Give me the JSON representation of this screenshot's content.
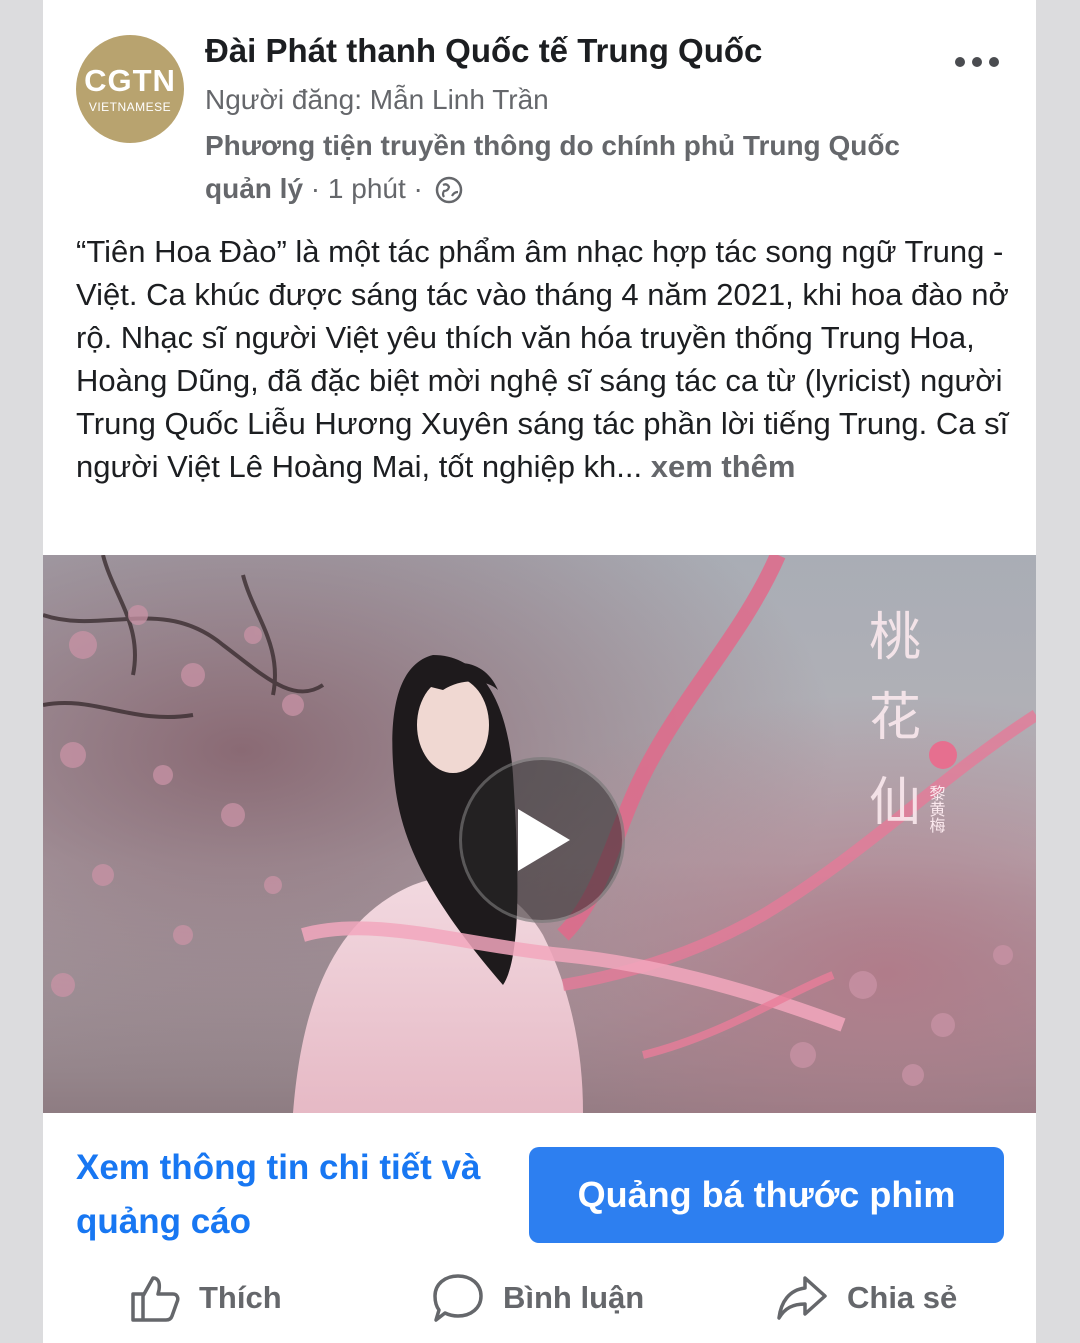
{
  "post": {
    "page_name": "Đài Phát thanh Quốc tế Trung Quốc",
    "avatar": {
      "logo_main": "CGTN",
      "logo_sub": "VIETNAMESE"
    },
    "poster_label": "Người đăng: Mẫn Linh  Trần",
    "gov_label": "Phương tiện truyền thông do chính phủ Trung Quốc quản lý",
    "time_meta": " · 1 phút · ",
    "text": "“Tiên Hoa Đào” là một tác phẩm âm nhạc hợp tác song ngữ Trung - Việt. Ca khúc được sáng tác vào tháng 4 năm 2021, khi hoa đào nở rộ. Nhạc sĩ người Việt yêu thích văn hóa truyền thống Trung Hoa, Hoàng Dũng, đã đặc biệt mời nghệ sĩ sáng tác ca từ (lyricist) người Trung Quốc Liễu Hương Xuyên sáng tác phần lời tiếng Trung. Ca sĩ người Việt Lê Hoàng Mai, tốt nghiệp kh...",
    "see_more": " xem thêm"
  },
  "media": {
    "video_title_chars": [
      "桃",
      "花",
      "仙"
    ],
    "video_artist": "黎黄梅",
    "icons": {
      "play": "play-icon"
    }
  },
  "cta": {
    "details_link": "Xem thông tin chi tiết và quảng cáo",
    "promote_button": "Quảng bá thước phim"
  },
  "actions": {
    "like": "Thích",
    "comment": "Bình luận",
    "share": "Chia sẻ"
  },
  "colors": {
    "brand_blue": "#1877f2",
    "button_blue": "#2d7ff0",
    "secondary_text": "#65676b",
    "avatar_gold": "#b8a36f"
  }
}
